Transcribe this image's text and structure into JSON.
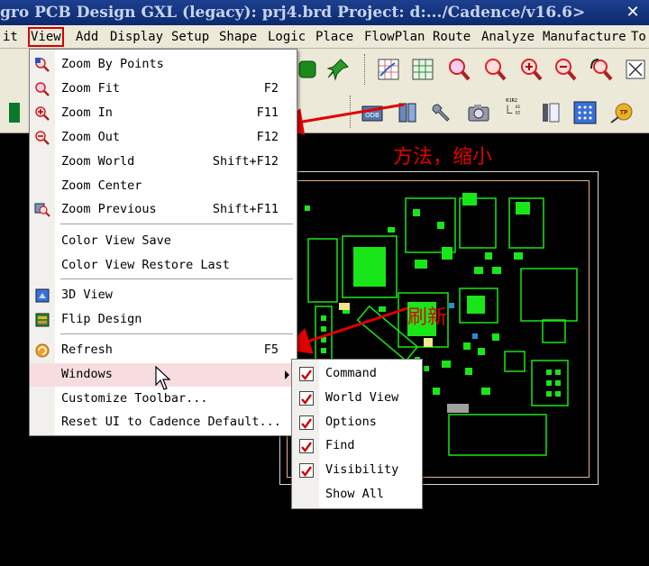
{
  "window": {
    "title": "gro PCB Design GXL (legacy): prj4.brd  Project: d:.../Cadence/v16.6>",
    "close_glyph": "✕"
  },
  "menubar": {
    "items": [
      "it",
      "View",
      "Add",
      "Display",
      "Setup",
      "Shape",
      "Logic",
      "Place",
      "FlowPlan",
      "Route",
      "Analyze",
      "Manufacture",
      "To"
    ],
    "active": "View"
  },
  "view_menu": {
    "items": [
      {
        "label": "Zoom By Points",
        "shortcut": "",
        "icon": "zoom-points-icon"
      },
      {
        "label": "Zoom Fit",
        "shortcut": "F2",
        "icon": "zoom-fit-icon"
      },
      {
        "label": "Zoom In",
        "shortcut": "F11",
        "icon": "zoom-in-icon"
      },
      {
        "label": "Zoom Out",
        "shortcut": "F12",
        "icon": "zoom-out-icon"
      },
      {
        "label": "Zoom World",
        "shortcut": "Shift+F12",
        "icon": ""
      },
      {
        "label": "Zoom Center",
        "shortcut": "",
        "icon": ""
      },
      {
        "label": "Zoom Previous",
        "shortcut": "Shift+F11",
        "icon": "zoom-previous-icon"
      },
      {
        "label": "Color View Save",
        "shortcut": "",
        "icon": ""
      },
      {
        "label": "Color View Restore Last",
        "shortcut": "",
        "icon": ""
      },
      {
        "label": "3D View",
        "shortcut": "",
        "icon": "3d-view-icon"
      },
      {
        "label": "Flip Design",
        "shortcut": "",
        "icon": "flip-design-icon"
      },
      {
        "label": "Refresh",
        "shortcut": "F5",
        "icon": "refresh-icon"
      },
      {
        "label": "Windows",
        "shortcut": "",
        "icon": ""
      },
      {
        "label": "Customize Toolbar...",
        "shortcut": "",
        "icon": ""
      },
      {
        "label": "Reset UI to Cadence Default...",
        "shortcut": "",
        "icon": ""
      }
    ]
  },
  "windows_submenu": {
    "items": [
      {
        "label": "Command",
        "checked": true
      },
      {
        "label": "World View",
        "checked": true
      },
      {
        "label": "Options",
        "checked": true
      },
      {
        "label": "Find",
        "checked": true
      },
      {
        "label": "Visibility",
        "checked": true
      },
      {
        "label": "Show All",
        "checked": false
      }
    ]
  },
  "annotations": {
    "zoom_out_note": "方法，缩小",
    "refresh_note": "刷新",
    "color": "#e00000"
  },
  "toolbar": {
    "tp_label": "TP",
    "odb_label": "ODB"
  },
  "colors": {
    "pcb_green": "#19e619",
    "menu_hover": "#f8dde0",
    "title_bar": "#0d2a6e"
  }
}
